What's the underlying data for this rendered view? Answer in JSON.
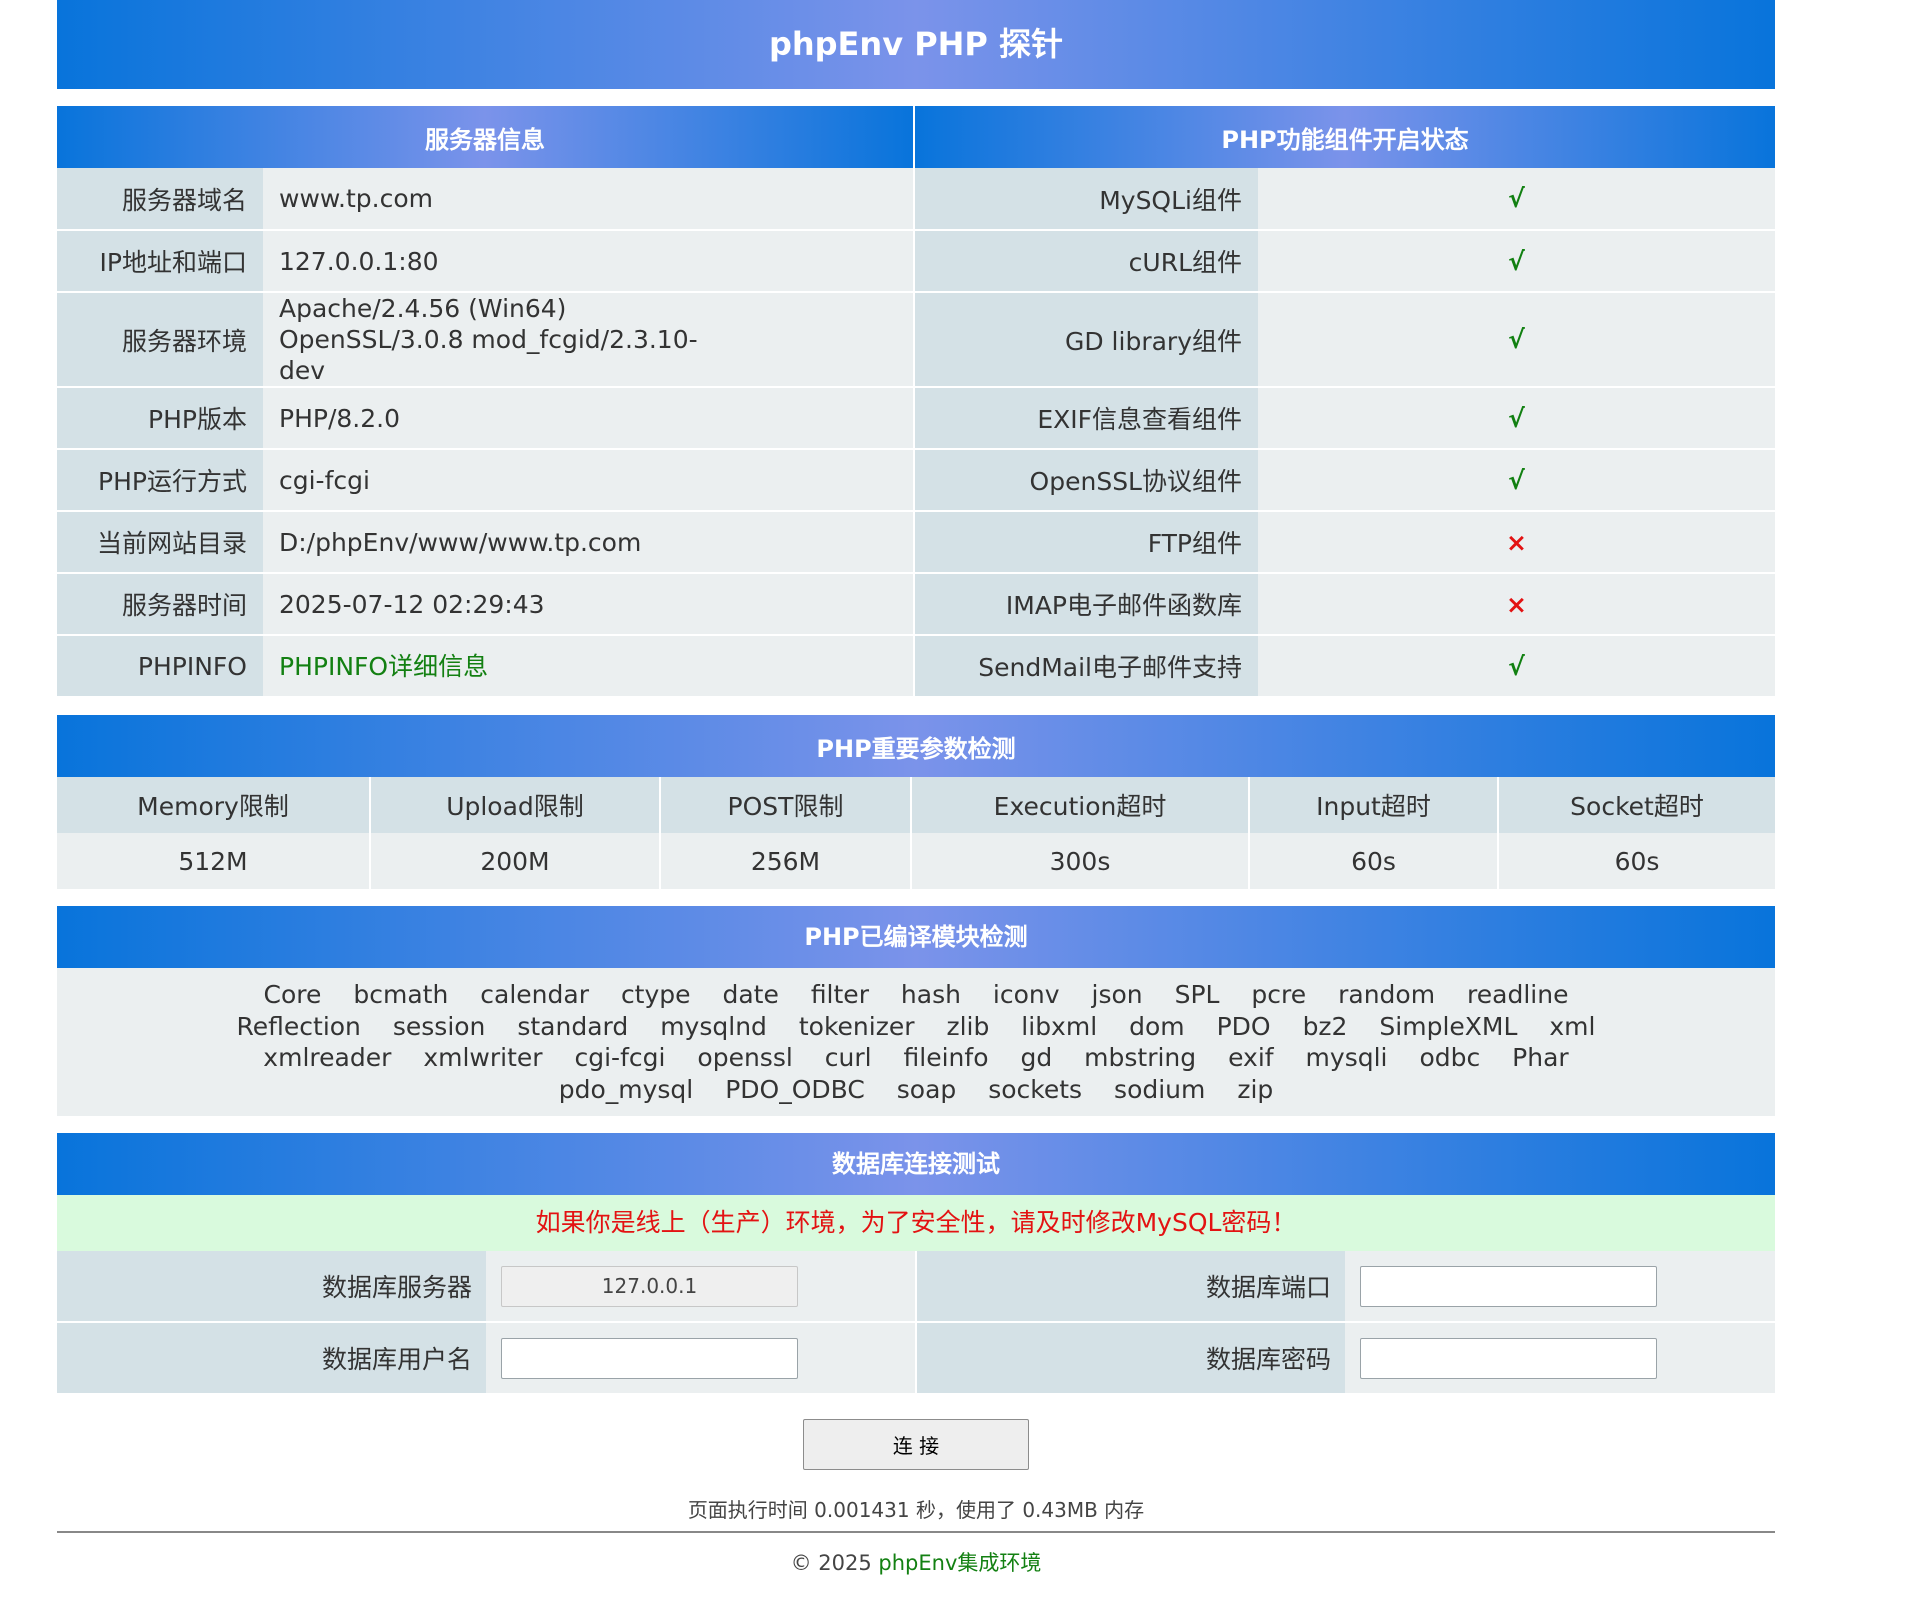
{
  "page": {
    "title": "phpEnv PHP 探针"
  },
  "server_info": {
    "header": "服务器信息",
    "rows": [
      {
        "label": "服务器域名",
        "value": "www.tp.com"
      },
      {
        "label": "IP地址和端口",
        "value": "127.0.0.1:80"
      },
      {
        "label": "服务器环境",
        "value": "Apache/2.4.56 (Win64) OpenSSL/3.0.8 mod_fcgid/2.3.10-dev"
      },
      {
        "label": "PHP版本",
        "value": "PHP/8.2.0"
      },
      {
        "label": "PHP运行方式",
        "value": "cgi-fcgi"
      },
      {
        "label": "当前网站目录",
        "value": "D:/phpEnv/www/www.tp.com"
      },
      {
        "label": "服务器时间",
        "value": "2025-07-12 02:29:43"
      },
      {
        "label": "PHPINFO",
        "value": "PHPINFO详细信息"
      }
    ]
  },
  "components": {
    "header": "PHP功能组件开启状态",
    "rows": [
      {
        "label": "MySQLi组件",
        "status": "√"
      },
      {
        "label": "cURL组件",
        "status": "√"
      },
      {
        "label": "GD library组件",
        "status": "√"
      },
      {
        "label": "EXIF信息查看组件",
        "status": "√"
      },
      {
        "label": "OpenSSL协议组件",
        "status": "√"
      },
      {
        "label": "FTP组件",
        "status": "×"
      },
      {
        "label": "IMAP电子邮件函数库",
        "status": "×"
      },
      {
        "label": "SendMail电子邮件支持",
        "status": "√"
      }
    ]
  },
  "params": {
    "header": "PHP重要参数检测",
    "columns": [
      "Memory限制",
      "Upload限制",
      "POST限制",
      "Execution超时",
      "Input超时",
      "Socket超时"
    ],
    "values": [
      "512M",
      "200M",
      "256M",
      "300s",
      "60s",
      "60s"
    ]
  },
  "modules": {
    "header": "PHP已编译模块检测",
    "items": [
      "Core",
      "bcmath",
      "calendar",
      "ctype",
      "date",
      "filter",
      "hash",
      "iconv",
      "json",
      "SPL",
      "pcre",
      "random",
      "readline",
      "Reflection",
      "session",
      "standard",
      "mysqlnd",
      "tokenizer",
      "zlib",
      "libxml",
      "dom",
      "PDO",
      "bz2",
      "SimpleXML",
      "xml",
      "xmlreader",
      "xmlwriter",
      "cgi-fcgi",
      "openssl",
      "curl",
      "fileinfo",
      "gd",
      "mbstring",
      "exif",
      "mysqli",
      "odbc",
      "Phar",
      "pdo_mysql",
      "PDO_ODBC",
      "soap",
      "sockets",
      "sodium",
      "zip"
    ]
  },
  "db_test": {
    "header": "数据库连接测试",
    "warning": "如果你是线上（生产）环境，为了安全性，请及时修改MySQL密码！",
    "server_label": "数据库服务器",
    "server_value": "127.0.0.1",
    "port_label": "数据库端口",
    "port_value": "",
    "user_label": "数据库用户名",
    "user_value": "",
    "password_label": "数据库密码",
    "password_value": "",
    "connect_label": "连 接"
  },
  "footer": {
    "exec_info": "页面执行时间 0.001431 秒，使用了 0.43MB 内存",
    "copyright_prefix": "© 2025 ",
    "brand": "phpEnv集成环境"
  },
  "colors": {
    "header_gradient_edge": "#0874db",
    "header_gradient_center": "#7b93ea",
    "label_bg": "#d4e1e6",
    "value_bg": "#ebeff0",
    "ok_green": "#118011",
    "fail_red": "#e31212",
    "warning_bg": "#d9fadd"
  }
}
